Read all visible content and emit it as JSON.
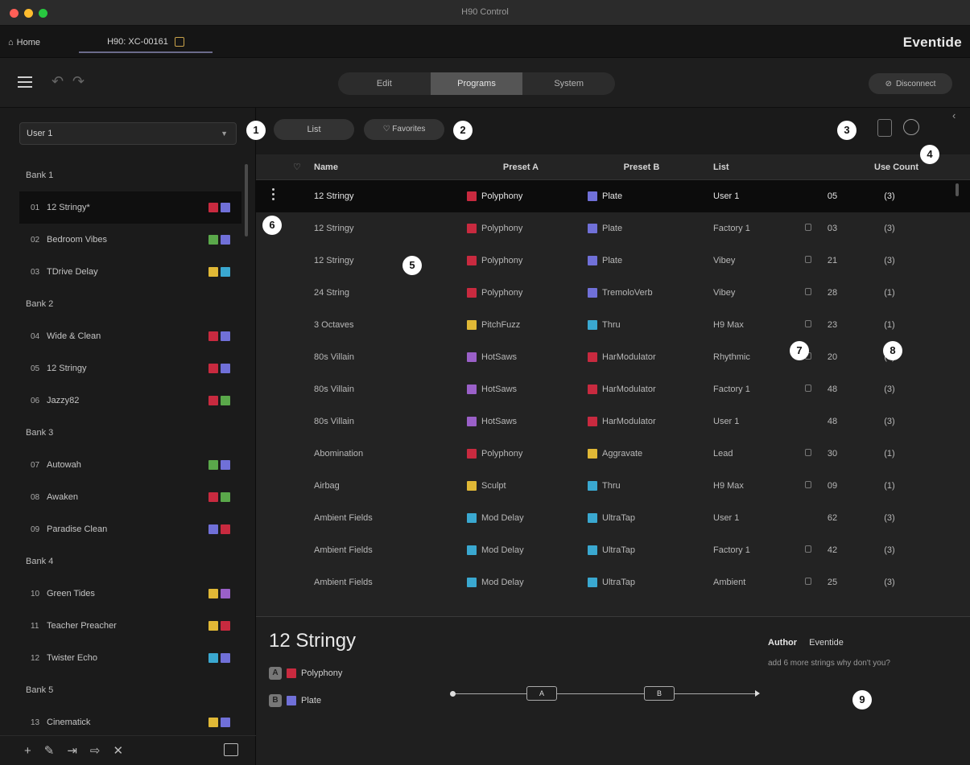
{
  "window": {
    "title": "H90 Control"
  },
  "tabs": {
    "home": "Home",
    "device": "H90: XC-00161"
  },
  "brand": "Eventide",
  "toolbar": {
    "segments": [
      "Edit",
      "Programs",
      "System"
    ],
    "active_segment": "Programs",
    "disconnect": "Disconnect"
  },
  "sidebar": {
    "list_select": "User 1",
    "banks": [
      {
        "name": "Bank 1",
        "presets": [
          {
            "num": "01",
            "name": "12 Stringy*",
            "icons": [
              "fx-red",
              "fx-blue"
            ],
            "selected": true
          },
          {
            "num": "02",
            "name": "Bedroom Vibes",
            "icons": [
              "fx-green",
              "fx-blue"
            ]
          },
          {
            "num": "03",
            "name": "TDrive Delay",
            "icons": [
              "fx-yellow",
              "fx-cyan"
            ]
          }
        ]
      },
      {
        "name": "Bank 2",
        "presets": [
          {
            "num": "04",
            "name": "Wide & Clean",
            "icons": [
              "fx-red",
              "fx-blue"
            ]
          },
          {
            "num": "05",
            "name": "12 Stringy",
            "icons": [
              "fx-red",
              "fx-blue"
            ]
          },
          {
            "num": "06",
            "name": "Jazzy82",
            "icons": [
              "fx-red",
              "fx-green"
            ]
          }
        ]
      },
      {
        "name": "Bank 3",
        "presets": [
          {
            "num": "07",
            "name": "Autowah",
            "icons": [
              "fx-green",
              "fx-blue"
            ]
          },
          {
            "num": "08",
            "name": "Awaken",
            "icons": [
              "fx-red",
              "fx-green"
            ]
          },
          {
            "num": "09",
            "name": "Paradise Clean",
            "icons": [
              "fx-blue",
              "fx-red"
            ]
          }
        ]
      },
      {
        "name": "Bank 4",
        "presets": [
          {
            "num": "10",
            "name": "Green Tides",
            "icons": [
              "fx-yellow",
              "fx-purple"
            ]
          },
          {
            "num": "11",
            "name": "Teacher Preacher",
            "icons": [
              "fx-yellow",
              "fx-red"
            ]
          },
          {
            "num": "12",
            "name": "Twister Echo",
            "icons": [
              "fx-cyan",
              "fx-blue"
            ]
          }
        ]
      },
      {
        "name": "Bank 5",
        "presets": [
          {
            "num": "13",
            "name": "Cinematick",
            "icons": [
              "fx-yellow",
              "fx-blue"
            ]
          }
        ]
      }
    ],
    "footer_icons": [
      "add-icon",
      "edit-icon",
      "import-icon",
      "export-icon",
      "delete-icon",
      "archive-icon"
    ]
  },
  "filters": {
    "list": "List",
    "favorites": "♡ Favorites"
  },
  "table": {
    "headers": {
      "name": "Name",
      "preset_a": "Preset A",
      "preset_b": "Preset B",
      "list": "List",
      "use_count": "Use Count"
    },
    "rows": [
      {
        "name": "12 Stringy",
        "a": "Polyphony",
        "a_icon": "fx-red",
        "b": "Plate",
        "b_icon": "fx-blue",
        "list": "User 1",
        "locked": false,
        "count": "05",
        "uc": "(3)",
        "selected": true
      },
      {
        "name": "12 Stringy",
        "a": "Polyphony",
        "a_icon": "fx-red",
        "b": "Plate",
        "b_icon": "fx-blue",
        "list": "Factory 1",
        "locked": true,
        "count": "03",
        "uc": "(3)"
      },
      {
        "name": "12 Stringy",
        "a": "Polyphony",
        "a_icon": "fx-red",
        "b": "Plate",
        "b_icon": "fx-blue",
        "list": "Vibey",
        "locked": true,
        "count": "21",
        "uc": "(3)"
      },
      {
        "name": "24 String",
        "a": "Polyphony",
        "a_icon": "fx-red",
        "b": "TremoloVerb",
        "b_icon": "fx-blue",
        "list": "Vibey",
        "locked": true,
        "count": "28",
        "uc": "(1)"
      },
      {
        "name": "3 Octaves",
        "a": "PitchFuzz",
        "a_icon": "fx-yellow",
        "b": "Thru",
        "b_icon": "fx-cyan",
        "list": "H9 Max",
        "locked": true,
        "count": "23",
        "uc": "(1)"
      },
      {
        "name": "80s Villain",
        "a": "HotSaws",
        "a_icon": "fx-purple",
        "b": "HarModulator",
        "b_icon": "fx-red",
        "list": "Rhythmic",
        "locked": true,
        "count": "20",
        "uc": "(3)"
      },
      {
        "name": "80s Villain",
        "a": "HotSaws",
        "a_icon": "fx-purple",
        "b": "HarModulator",
        "b_icon": "fx-red",
        "list": "Factory 1",
        "locked": true,
        "count": "48",
        "uc": "(3)"
      },
      {
        "name": "80s Villain",
        "a": "HotSaws",
        "a_icon": "fx-purple",
        "b": "HarModulator",
        "b_icon": "fx-red",
        "list": "User 1",
        "locked": false,
        "count": "48",
        "uc": "(3)"
      },
      {
        "name": "Abomination",
        "a": "Polyphony",
        "a_icon": "fx-red",
        "b": "Aggravate",
        "b_icon": "fx-yellow",
        "list": "Lead",
        "locked": true,
        "count": "30",
        "uc": "(1)"
      },
      {
        "name": "Airbag",
        "a": "Sculpt",
        "a_icon": "fx-yellow",
        "b": "Thru",
        "b_icon": "fx-cyan",
        "list": "H9 Max",
        "locked": true,
        "count": "09",
        "uc": "(1)"
      },
      {
        "name": "Ambient Fields",
        "a": "Mod Delay",
        "a_icon": "fx-cyan",
        "b": "UltraTap",
        "b_icon": "fx-cyan",
        "list": "User 1",
        "locked": false,
        "count": "62",
        "uc": "(3)"
      },
      {
        "name": "Ambient Fields",
        "a": "Mod Delay",
        "a_icon": "fx-cyan",
        "b": "UltraTap",
        "b_icon": "fx-cyan",
        "list": "Factory 1",
        "locked": true,
        "count": "42",
        "uc": "(3)"
      },
      {
        "name": "Ambient Fields",
        "a": "Mod Delay",
        "a_icon": "fx-cyan",
        "b": "UltraTap",
        "b_icon": "fx-cyan",
        "list": "Ambient",
        "locked": true,
        "count": "25",
        "uc": "(3)"
      }
    ]
  },
  "detail": {
    "title": "12 Stringy",
    "a_label": "A",
    "a_name": "Polyphony",
    "b_label": "B",
    "b_name": "Plate",
    "chain_a": "A",
    "chain_b": "B",
    "author_label": "Author",
    "author": "Eventide",
    "description": "add 6 more strings why don't you?"
  },
  "callouts": [
    "1",
    "2",
    "3",
    "4",
    "5",
    "6",
    "7",
    "8",
    "9"
  ],
  "colors": {
    "accent": "#6a6a8a",
    "selected_row": "#0c0c0c",
    "background": "#1a1a1a"
  }
}
